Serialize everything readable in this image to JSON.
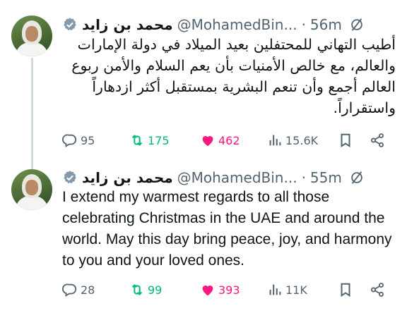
{
  "tweets": [
    {
      "display_name": "محمد بن زايد",
      "handle": "@MohamedBin...",
      "separator": "·",
      "time": "56m",
      "text": "أطيب التهاني للمحتفلين بعيد الميلاد في دولة الإمارات والعالم، مع خالص الأمنيات بأن يعم السلام والأمن ربوع العالم أجمع وأن تنعم البشرية بمستقبل أكثر ازدهاراً واستقراراً.",
      "replies": "95",
      "retweets": "175",
      "likes": "462",
      "views": "15.6K"
    },
    {
      "display_name": "محمد بن زايد",
      "handle": "@MohamedBin...",
      "separator": "·",
      "time": "55m",
      "text": "I extend my warmest regards to all those celebrating Christmas in the UAE and around the world. May this day bring peace, joy, and harmony to you and your loved ones.",
      "replies": "28",
      "retweets": "99",
      "likes": "393",
      "views": "11K"
    }
  ],
  "colors": {
    "text": "#0f1419",
    "muted": "#536471",
    "retweet": "#00ba7c",
    "like": "#f91880",
    "verified": "#829aab"
  },
  "icons": [
    "verified-badge-icon",
    "edited-icon",
    "reply-icon",
    "retweet-icon",
    "heart-icon",
    "views-icon",
    "bookmark-icon",
    "share-icon"
  ]
}
